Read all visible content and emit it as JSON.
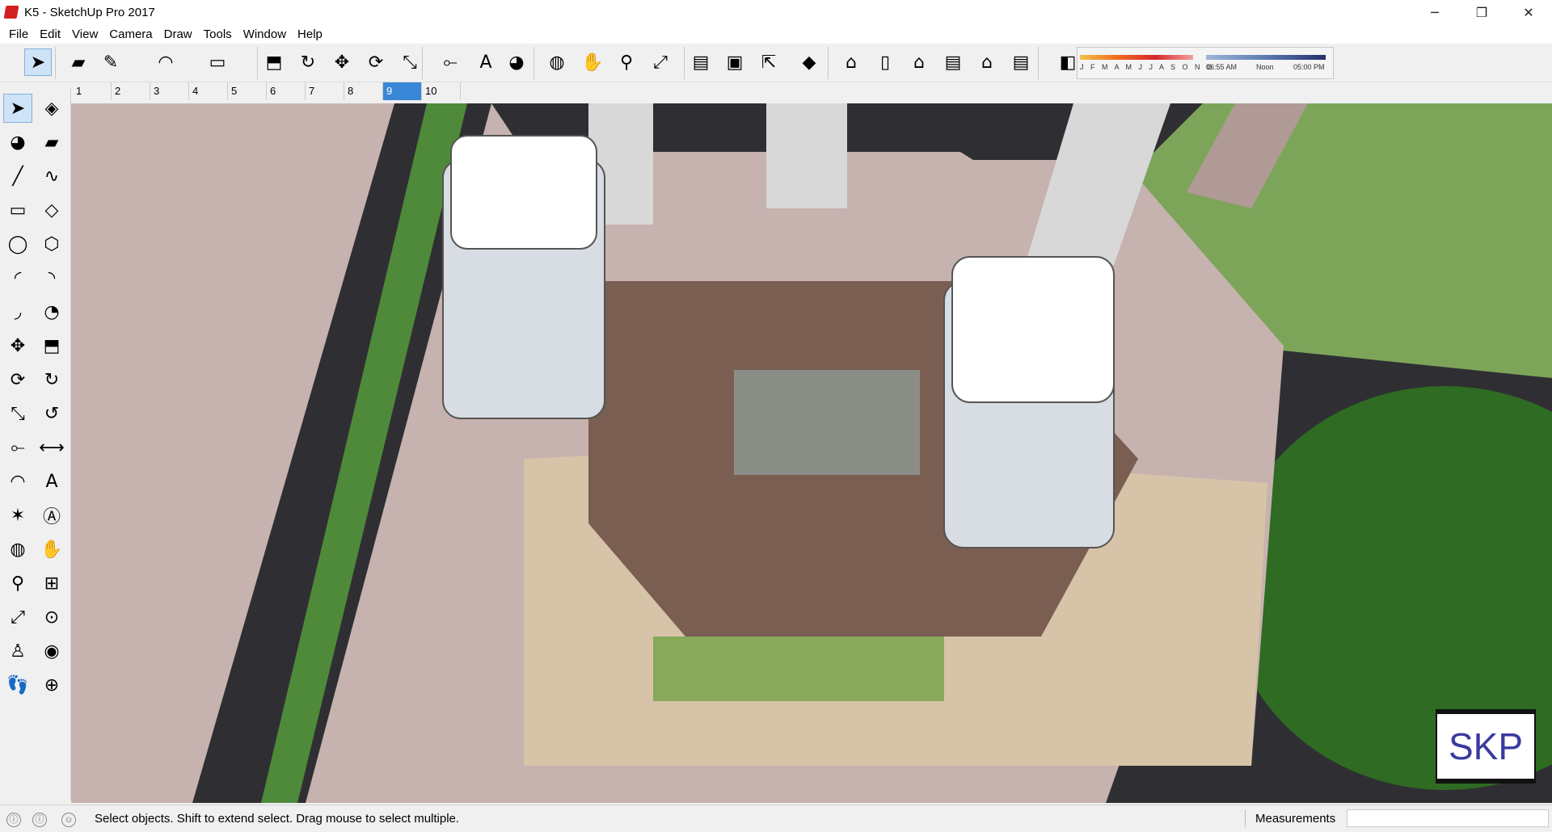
{
  "window": {
    "title": "K5 - SketchUp Pro 2017",
    "minimize": "─",
    "maximize": "❐",
    "close": "✕"
  },
  "menus": [
    "File",
    "Edit",
    "View",
    "Camera",
    "Draw",
    "Tools",
    "Window",
    "Help"
  ],
  "toolbar": {
    "icons": [
      "select-icon",
      "eraser-icon",
      "pencil-icon",
      "freehand-arc-icon",
      "rectangle-icon",
      "push-pull-icon",
      "follow-me-icon",
      "move-icon",
      "rotate-icon",
      "scale-icon",
      "tape-measure-icon",
      "text-icon",
      "paint-bucket-icon",
      "orbit-icon",
      "pan-icon",
      "zoom-icon",
      "zoom-extents-icon",
      "warehouse-icon",
      "share-model-icon",
      "extension-icon",
      "ruby-icon",
      "iso-view-icon",
      "top-view-icon",
      "front-view-icon",
      "right-view-icon",
      "back-view-icon",
      "left-view-icon",
      "shadows-icon"
    ],
    "months": "J F M A M J J A S O N D",
    "time_start": "06:55 AM",
    "time_noon": "Noon",
    "time_end": "05:00 PM"
  },
  "scenes": [
    "1",
    "2",
    "3",
    "4",
    "5",
    "6",
    "7",
    "8",
    "9",
    "10"
  ],
  "active_scene": "9",
  "left_tools": [
    "select-icon",
    "make-component-icon",
    "paint-bucket-icon",
    "eraser-icon",
    "line-icon",
    "freehand-icon",
    "rectangle-icon",
    "rotated-rectangle-icon",
    "circle-icon",
    "polygon-icon",
    "arc-icon",
    "two-point-arc-icon",
    "three-point-arc-icon",
    "pie-icon",
    "move-icon",
    "push-pull-icon",
    "rotate-icon",
    "follow-me-icon",
    "scale-icon",
    "offset-icon",
    "tape-measure-icon",
    "dimension-icon",
    "protractor-icon",
    "text-icon",
    "axes-icon",
    "3d-text-icon",
    "orbit-icon",
    "pan-icon",
    "zoom-icon",
    "zoom-window-icon",
    "zoom-extents-icon",
    "previous-icon",
    "position-camera-icon",
    "look-around-icon",
    "walk-icon",
    "section-plane-icon"
  ],
  "watermark": "SKP",
  "colors": {
    "road": "#2f2f33",
    "grass": "#4f8a3a",
    "pink": "#c6b2ae",
    "deck": "#7a5e52",
    "tower": "#d8dde3",
    "accent": "#3a86d6"
  },
  "status": {
    "text": "Select objects. Shift to extend select. Drag mouse to select multiple.",
    "measurements_label": "Measurements",
    "measurements_value": ""
  }
}
